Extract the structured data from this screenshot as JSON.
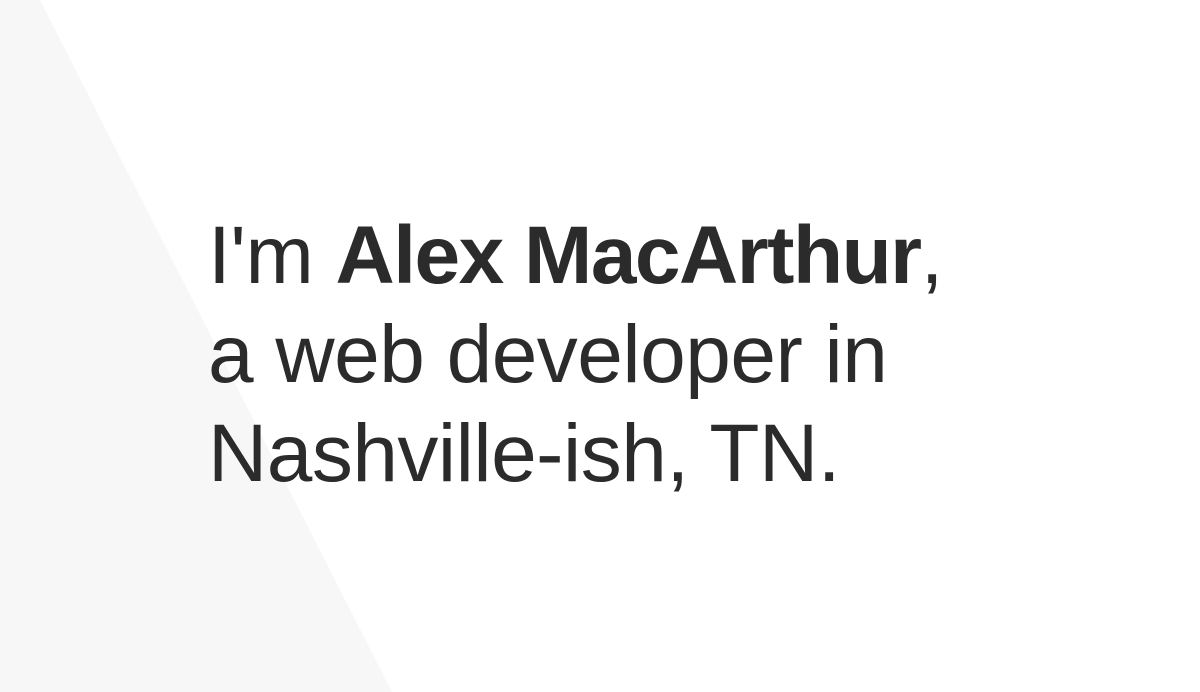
{
  "colors": {
    "background": "#ffffff",
    "shape": "#f7f7f7",
    "text": "#2b2b2b"
  },
  "intro": {
    "prefix": "I'm ",
    "name": "Alex MacArthur",
    "suffix": ",",
    "line2": "a web developer in",
    "line3": "Nashville-ish, TN."
  }
}
